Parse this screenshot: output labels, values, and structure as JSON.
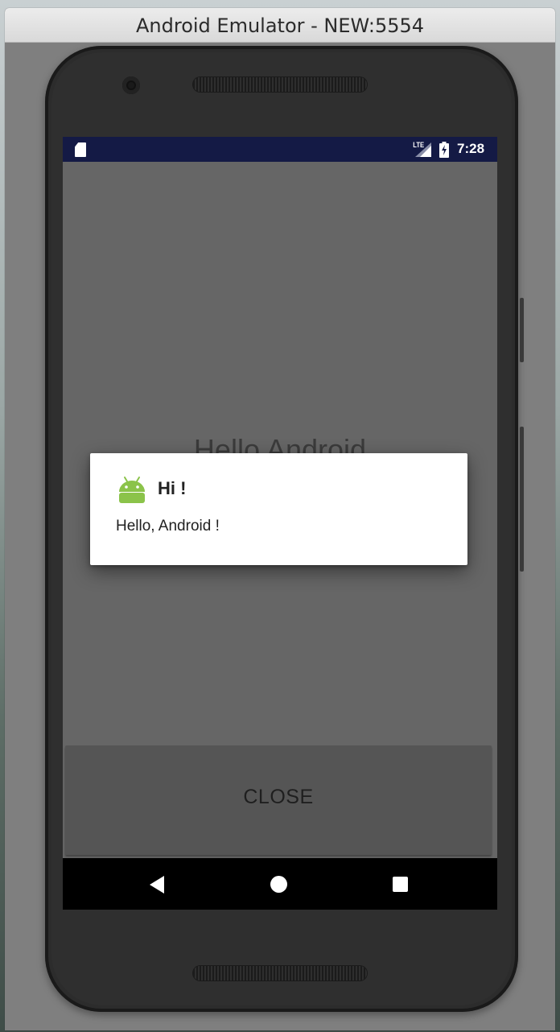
{
  "window": {
    "title": "Android Emulator - NEW:5554"
  },
  "statusbar": {
    "network_label": "LTE",
    "time": "7:28",
    "icons": [
      "sd-card-icon",
      "signal-icon",
      "battery-charging-icon"
    ]
  },
  "app": {
    "background_text": "Hello Android",
    "close_button_label": "CLOSE"
  },
  "dialog": {
    "title": "Hi !",
    "message": "Hello, Android !",
    "icon": "android-icon"
  },
  "navbar": {
    "icons": [
      "back-icon",
      "home-icon",
      "recents-icon"
    ]
  },
  "colors": {
    "statusbar": "#141a45",
    "app_background": "#666666",
    "android_green": "#8bc34a",
    "dialog_background": "#ffffff"
  }
}
